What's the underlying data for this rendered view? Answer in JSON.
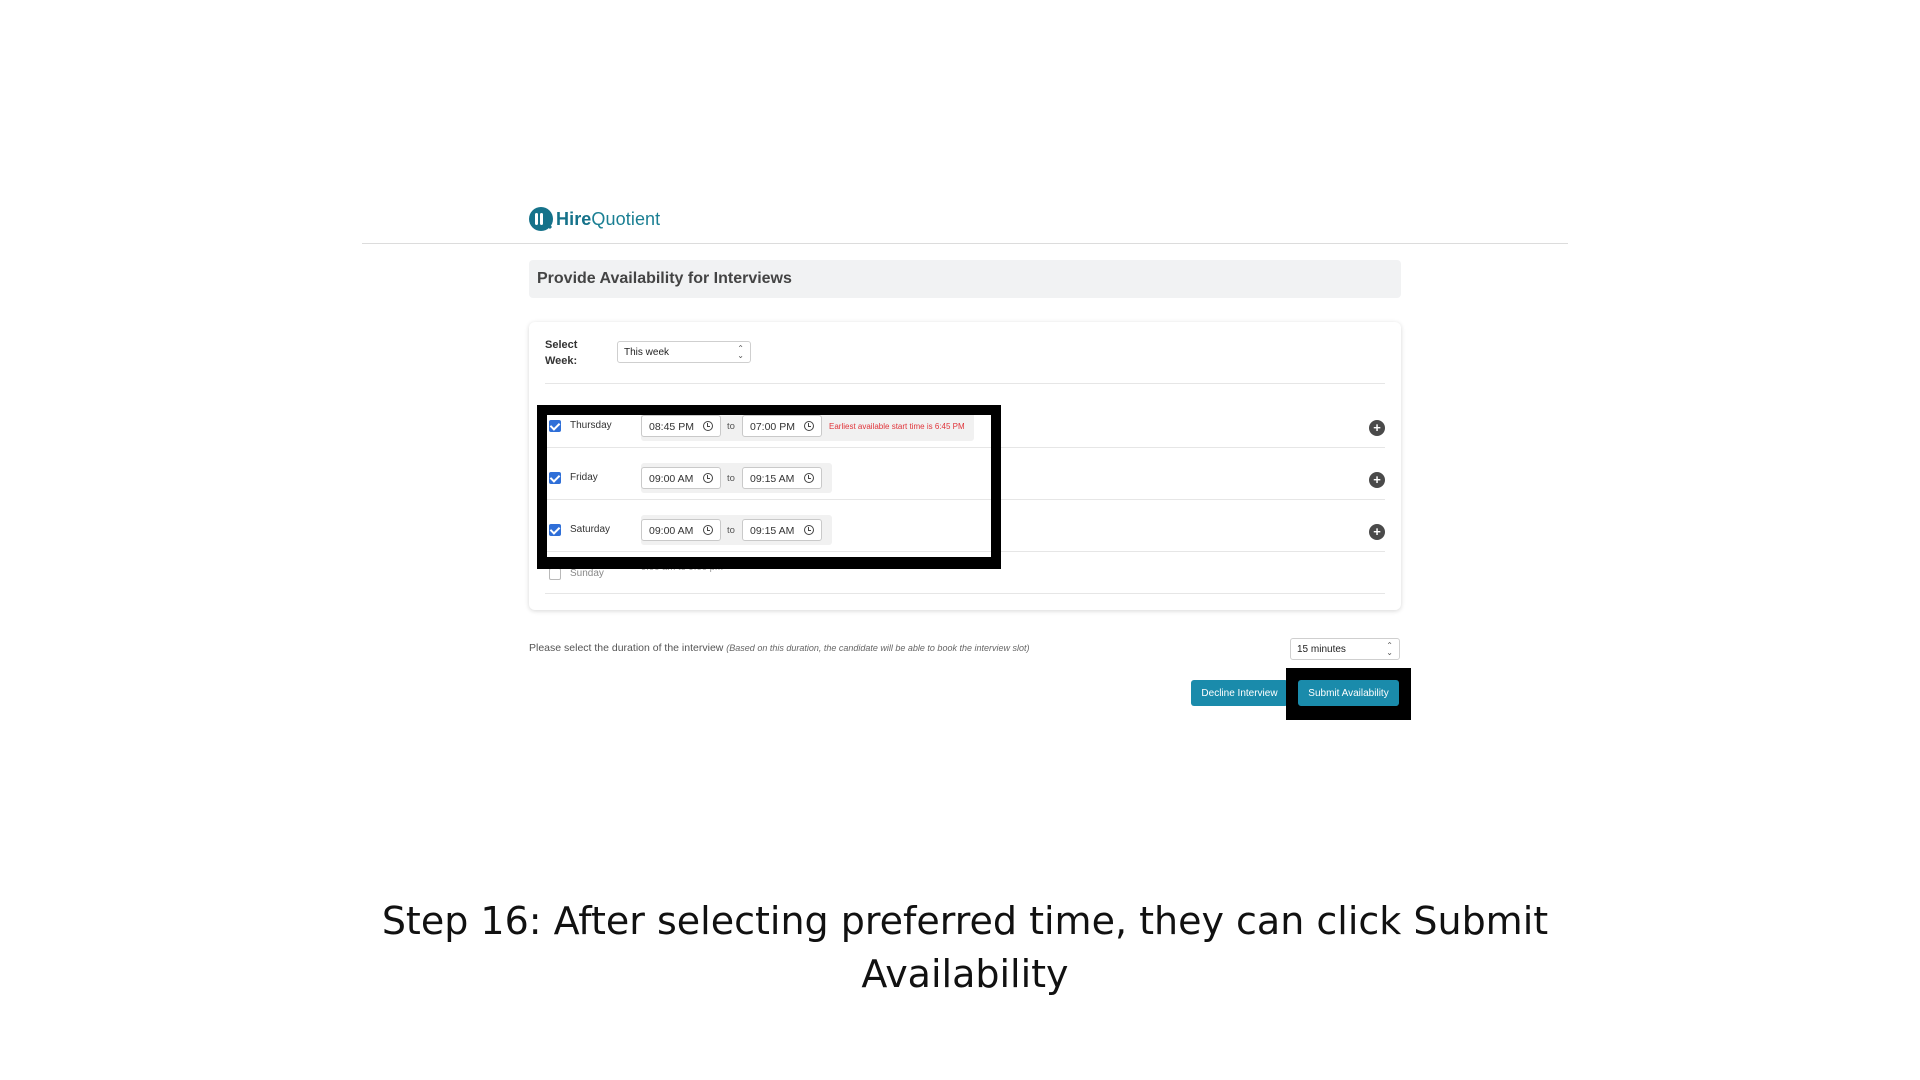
{
  "brand": {
    "name_bold": "Hire",
    "name_light": "Quotient",
    "color": "#1a7f93"
  },
  "page_title": "Provide Availability for Interviews",
  "week": {
    "label": "Select Week:",
    "selected": "This week"
  },
  "days": [
    {
      "name": "Thursday",
      "checked": true,
      "start": "08:45 PM",
      "end": "07:00 PM",
      "error": "Earliest available start time is 6:45 PM"
    },
    {
      "name": "Friday",
      "checked": true,
      "start": "09:00 AM",
      "end": "09:15 AM"
    },
    {
      "name": "Saturday",
      "checked": true,
      "start": "09:00 AM",
      "end": "09:15 AM"
    },
    {
      "name": "Sunday",
      "checked": false,
      "summary": "9:00 am  to  9:00 pm"
    }
  ],
  "to_label": "to",
  "duration": {
    "label": "Please select the duration of the interview",
    "note": "(Based on this duration, the candidate will be able to book the interview slot)",
    "selected": "15 minutes"
  },
  "buttons": {
    "decline": "Decline Interview",
    "submit": "Submit Availability"
  },
  "colors": {
    "accent": "#1a8bab",
    "checkbox": "#2f6fd8",
    "error": "#e0343a",
    "highlight": "#000000"
  },
  "caption": "Step 16: After selecting preferred time, they can click Submit Availability"
}
